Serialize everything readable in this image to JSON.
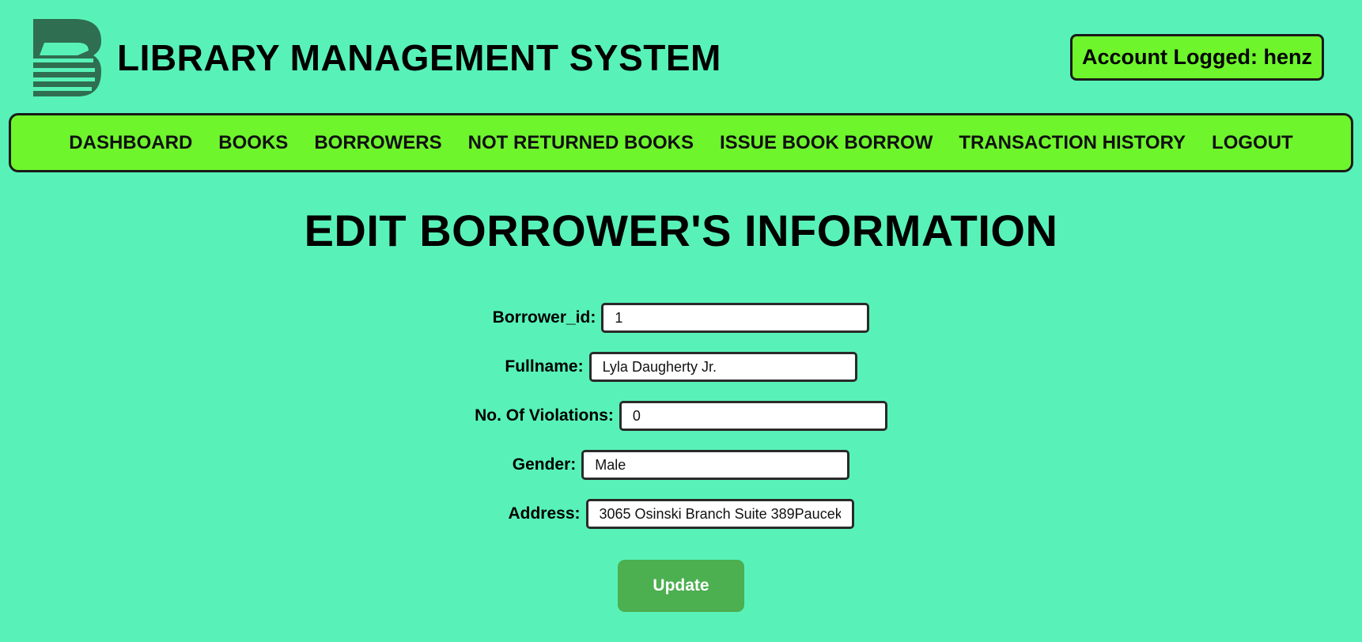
{
  "header": {
    "app_title": "LIBRARY MANAGEMENT SYSTEM",
    "account_text": "Account Logged: henz",
    "logo_icon": "book-stack-logo-icon"
  },
  "nav": {
    "items": [
      {
        "label": "DASHBOARD"
      },
      {
        "label": "BOOKS"
      },
      {
        "label": "BORROWERS"
      },
      {
        "label": "NOT RETURNED BOOKS"
      },
      {
        "label": "ISSUE BOOK BORROW"
      },
      {
        "label": "TRANSACTION HISTORY"
      },
      {
        "label": "LOGOUT"
      }
    ]
  },
  "main": {
    "title": "EDIT BORROWER'S INFORMATION",
    "fields": [
      {
        "label": "Borrower_id:",
        "value": "1"
      },
      {
        "label": "Fullname:",
        "value": "Lyla Daugherty Jr."
      },
      {
        "label": "No. Of Violations:",
        "value": "0"
      },
      {
        "label": "Gender:",
        "value": "Male"
      },
      {
        "label": "Address:",
        "value": "3065 Osinski Branch Suite 389Paucek"
      }
    ],
    "submit_label": "Update"
  },
  "colors": {
    "background": "#58f2b8",
    "nav_background": "#6ef52c",
    "button": "#4caf50",
    "logo": "#2e6b4e"
  }
}
